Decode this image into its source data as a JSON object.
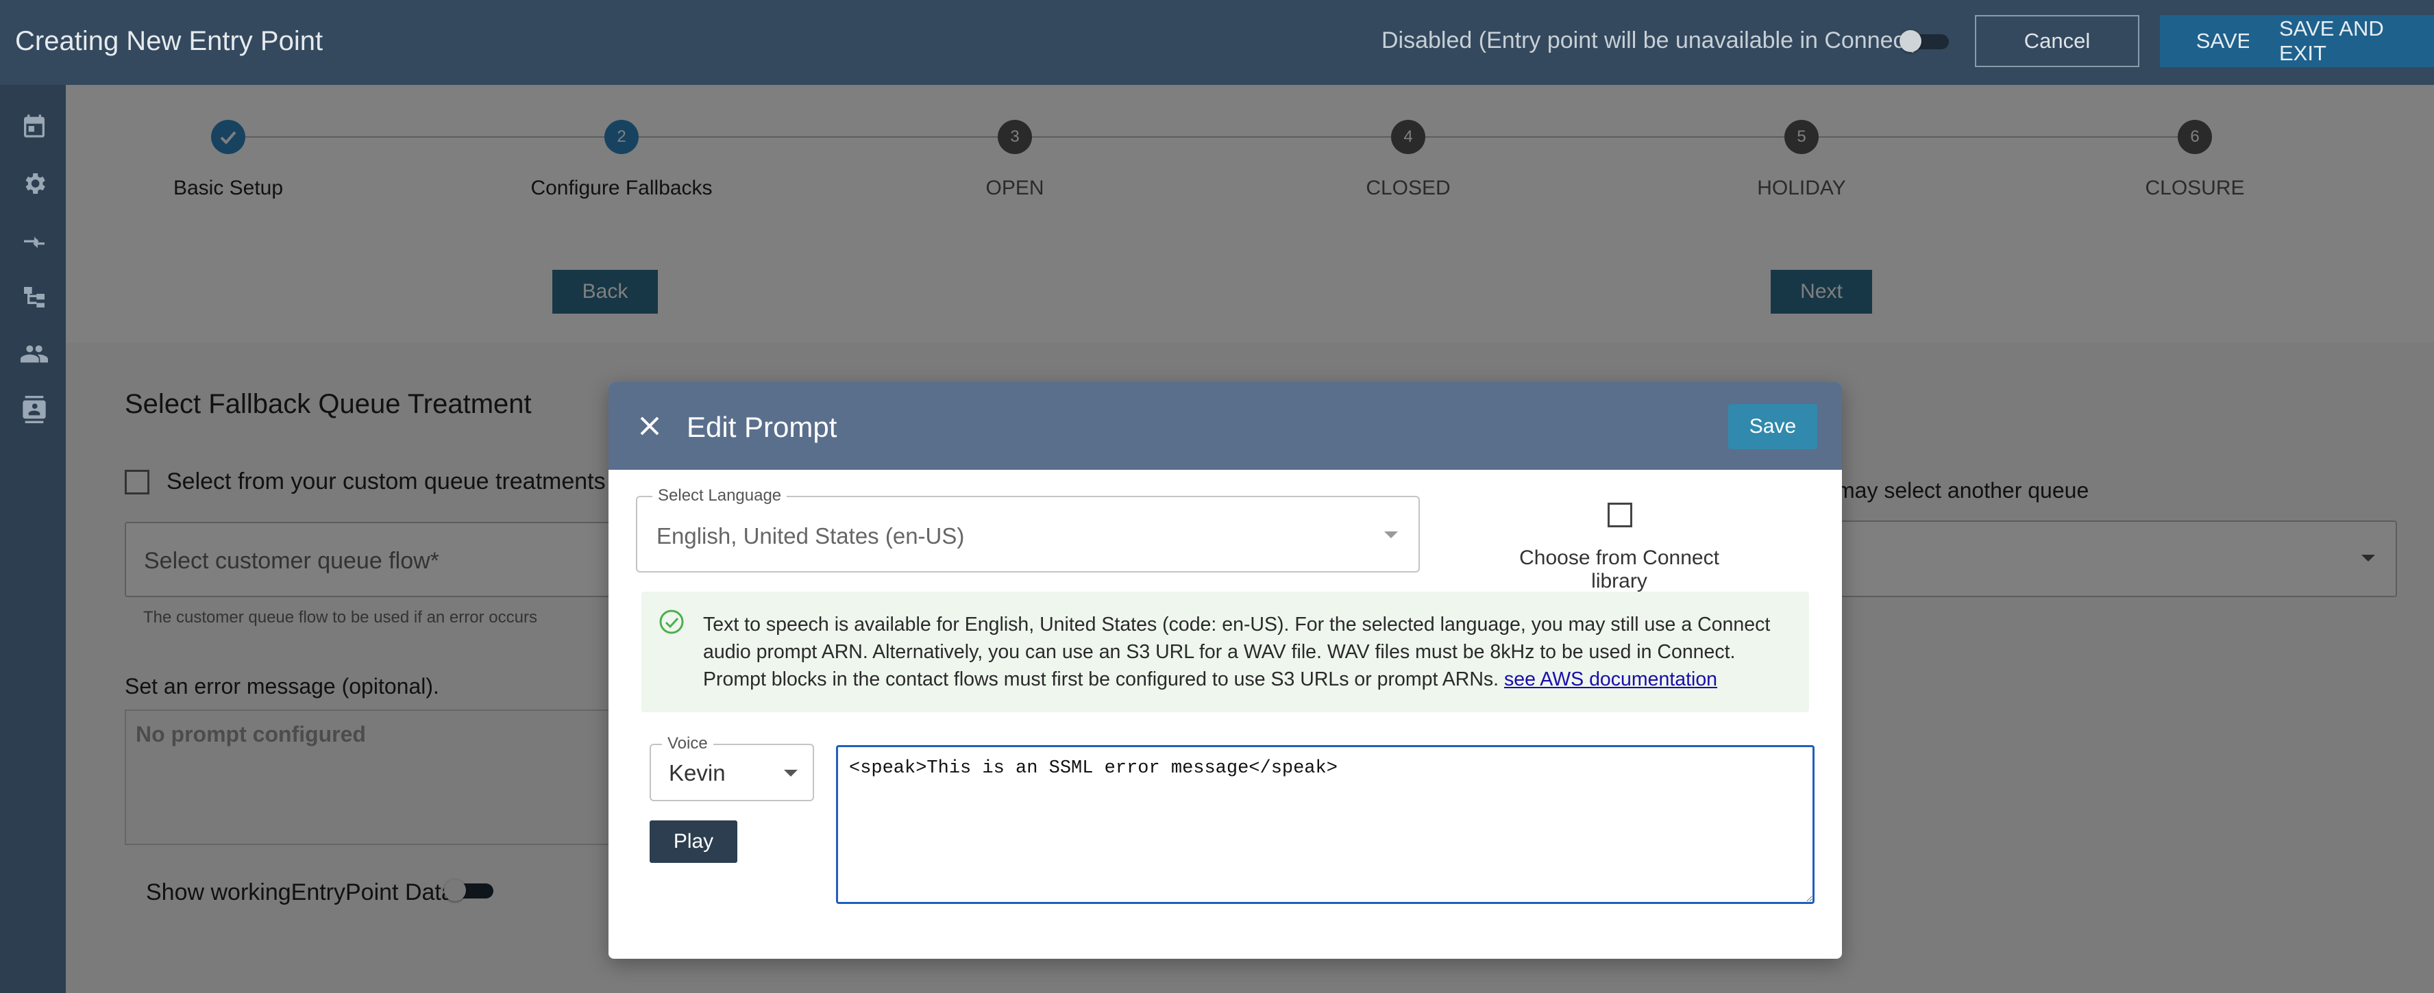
{
  "header": {
    "title": "Creating New Entry Point",
    "status_text": "Disabled (Entry point will be unavailable in Connect)",
    "cancel_label": "Cancel",
    "save_label": "SAVE",
    "save_exit_label": "SAVE AND EXIT"
  },
  "sidebar": {
    "icons": [
      "calendar-icon",
      "gear-icon",
      "transfer-icon",
      "flow-icon",
      "users-icon",
      "contacts-icon"
    ]
  },
  "stepper": {
    "steps": [
      {
        "number": "1",
        "label": "Basic Setup",
        "state": "complete"
      },
      {
        "number": "2",
        "label": "Configure Fallbacks",
        "state": "active"
      },
      {
        "number": "3",
        "label": "OPEN",
        "state": "pending"
      },
      {
        "number": "4",
        "label": "CLOSED",
        "state": "pending"
      },
      {
        "number": "5",
        "label": "HOLIDAY",
        "state": "pending"
      },
      {
        "number": "6",
        "label": "CLOSURE",
        "state": "pending"
      }
    ],
    "back_label": "Back",
    "next_label": "Next"
  },
  "fallback": {
    "section_title": "Select Fallback Queue Treatment",
    "custom_check_label": "Select from your custom queue treatments",
    "queue_flow_label": "Select customer queue flow*",
    "queue_flow_helper": "The customer queue flow to be used if an error occurs",
    "error_message_label": "Set an error message (opitonal).",
    "error_message_placeholder": "No prompt configured",
    "show_data_label": "Show workingEntryPoint Data",
    "right_label": "may select another queue"
  },
  "modal": {
    "title": "Edit Prompt",
    "save_label": "Save",
    "language_label": "Select Language",
    "language_value": "English, United States (en-US)",
    "library_label": "Choose from Connect library",
    "info_text": "Text to speech is available for English, United States (code: en-US). For the selected language, you may still use a Connect audio prompt ARN. Alternatively, you can use an S3 URL for a WAV file. WAV files must be 8kHz to be used in Connect. Prompt blocks in the contact flows must first be configured to use S3 URLs or prompt ARNs.",
    "info_link": "see AWS documentation",
    "voice_label": "Voice",
    "voice_value": "Kevin",
    "play_label": "Play",
    "ssml_value": "<speak>This is an SSML error message</speak>"
  },
  "colors": {
    "topbar": "#34495e",
    "sidebar": "#2c3e50",
    "accent": "#1f618d",
    "modal_header": "#5a6f8c",
    "step_complete": "#2e86c1",
    "step_pending": "#555555",
    "info_bg": "#eef6ed",
    "success": "#4caf50"
  }
}
